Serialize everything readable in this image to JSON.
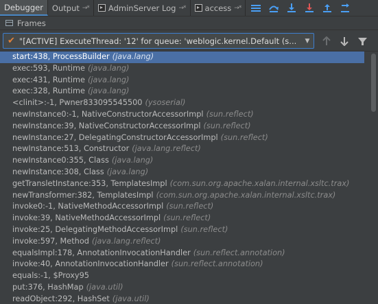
{
  "tabs": [
    {
      "label": "Debugger",
      "active": true,
      "pin": ""
    },
    {
      "label": "Output",
      "active": false,
      "pin": "→*"
    },
    {
      "label": "AdminServer Log",
      "active": false,
      "pin": "→*"
    },
    {
      "label": "access",
      "active": false,
      "pin": "→*"
    }
  ],
  "toolbar_icons": [
    "menu-icon",
    "step-over-icon",
    "step-into-icon",
    "force-step-into-icon",
    "step-out-icon",
    "run-to-cursor-icon"
  ],
  "frames_header": {
    "label": "Frames"
  },
  "thread": {
    "text": "\"[ACTIVE] ExecuteThread: '12' for queue: 'weblogic.kernel.Default (s..."
  },
  "frames": [
    {
      "method": "start:438, ProcessBuilder",
      "pkg": "(java.lang)",
      "selected": true
    },
    {
      "method": "exec:593, Runtime",
      "pkg": "(java.lang)"
    },
    {
      "method": "exec:431, Runtime",
      "pkg": "(java.lang)"
    },
    {
      "method": "exec:328, Runtime",
      "pkg": "(java.lang)"
    },
    {
      "method": "<clinit>:-1, Pwner833095545500",
      "pkg": "(ysoserial)"
    },
    {
      "method": "newInstance0:-1, NativeConstructorAccessorImpl",
      "pkg": "(sun.reflect)"
    },
    {
      "method": "newInstance:39, NativeConstructorAccessorImpl",
      "pkg": "(sun.reflect)"
    },
    {
      "method": "newInstance:27, DelegatingConstructorAccessorImpl",
      "pkg": "(sun.reflect)"
    },
    {
      "method": "newInstance:513, Constructor",
      "pkg": "(java.lang.reflect)"
    },
    {
      "method": "newInstance0:355, Class",
      "pkg": "(java.lang)"
    },
    {
      "method": "newInstance:308, Class",
      "pkg": "(java.lang)"
    },
    {
      "method": "getTransletInstance:353, TemplatesImpl",
      "pkg": "(com.sun.org.apache.xalan.internal.xsltc.trax)"
    },
    {
      "method": "newTransformer:382, TemplatesImpl",
      "pkg": "(com.sun.org.apache.xalan.internal.xsltc.trax)"
    },
    {
      "method": "invoke0:-1, NativeMethodAccessorImpl",
      "pkg": "(sun.reflect)"
    },
    {
      "method": "invoke:39, NativeMethodAccessorImpl",
      "pkg": "(sun.reflect)"
    },
    {
      "method": "invoke:25, DelegatingMethodAccessorImpl",
      "pkg": "(sun.reflect)"
    },
    {
      "method": "invoke:597, Method",
      "pkg": "(java.lang.reflect)"
    },
    {
      "method": "equalsImpl:178, AnnotationInvocationHandler",
      "pkg": "(sun.reflect.annotation)"
    },
    {
      "method": "invoke:40, AnnotationInvocationHandler",
      "pkg": "(sun.reflect.annotation)"
    },
    {
      "method": "equals:-1, $Proxy95",
      "pkg": ""
    },
    {
      "method": "put:376, HashMap",
      "pkg": "(java.util)"
    },
    {
      "method": "readObject:292, HashSet",
      "pkg": "(java.util)"
    }
  ]
}
